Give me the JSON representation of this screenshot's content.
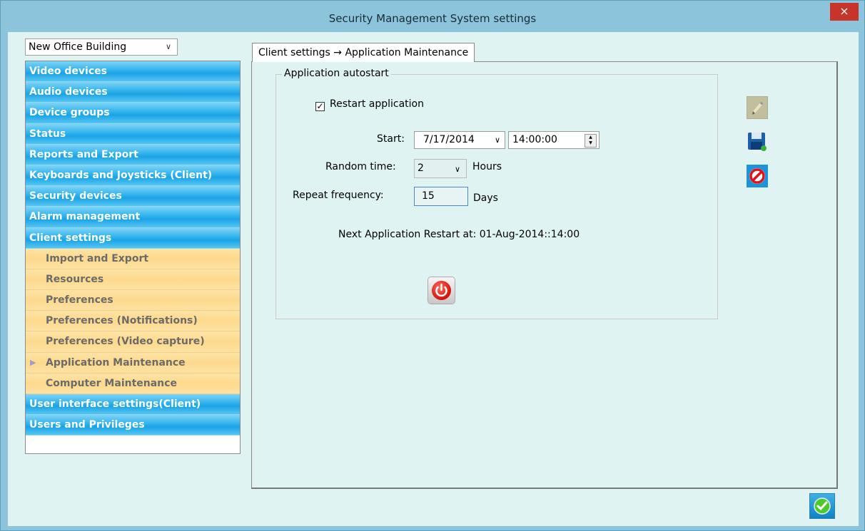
{
  "window": {
    "title": "Security Management System settings",
    "close_label": "×"
  },
  "building_select": {
    "value": "New Office Building"
  },
  "sidebar": {
    "items": [
      {
        "label": "Video devices",
        "kind": "category"
      },
      {
        "label": "Audio devices",
        "kind": "category"
      },
      {
        "label": "Device groups",
        "kind": "category"
      },
      {
        "label": "Status",
        "kind": "category"
      },
      {
        "label": "Reports and Export",
        "kind": "category"
      },
      {
        "label": "Keyboards and Joysticks (Client)",
        "kind": "category"
      },
      {
        "label": "Security devices",
        "kind": "category"
      },
      {
        "label": "Alarm management",
        "kind": "category"
      },
      {
        "label": "Client settings",
        "kind": "category"
      },
      {
        "label": "Import and Export",
        "kind": "sub"
      },
      {
        "label": "Resources",
        "kind": "sub"
      },
      {
        "label": "Preferences",
        "kind": "sub"
      },
      {
        "label": "Preferences (Notifications)",
        "kind": "sub"
      },
      {
        "label": "Preferences (Video capture)",
        "kind": "sub"
      },
      {
        "label": "Application Maintenance",
        "kind": "sub",
        "selected": true
      },
      {
        "label": "Computer Maintenance",
        "kind": "sub"
      },
      {
        "label": "User interface settings(Client)",
        "kind": "category"
      },
      {
        "label": "Users and Privileges",
        "kind": "category"
      }
    ]
  },
  "tab": {
    "label": "Client settings → Application Maintenance"
  },
  "autostart": {
    "group_title": "Application autostart",
    "restart_checkbox": {
      "label": "Restart application",
      "checked": true
    },
    "start_label": "Start:",
    "start_date": "7/17/2014",
    "start_time": "14:00:00",
    "random_label": "Random time:",
    "random_value": "2",
    "random_unit": "Hours",
    "repeat_label": "Repeat frequency:",
    "repeat_value": "15",
    "repeat_unit": "Days",
    "next_restart": "Next Application Restart at: 01-Aug-2014::14:00"
  },
  "icons": {
    "edit": "pencil-icon",
    "save": "floppy-disk-icon",
    "cancel": "no-entry-icon",
    "power": "power-icon",
    "ok": "checkmark-icon",
    "close": "close-icon"
  },
  "colors": {
    "window_bg": "#8cc4dc",
    "panel_bg": "#dff3f3",
    "category_blue": "#1aa3e6",
    "sub_orange": "#fdd98c",
    "close_red": "#c7352a"
  }
}
